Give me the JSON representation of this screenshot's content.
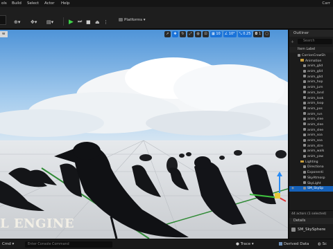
{
  "menu": {
    "items": [
      "ols",
      "Build",
      "Select",
      "Actor",
      "Help"
    ],
    "project_label": "Carr"
  },
  "toolbar": {
    "platforms_label": "Platforms",
    "play_color": "#3fd34a"
  },
  "viewport": {
    "mode_label": "w",
    "grid_snap": "10",
    "rotation_snap": "10°",
    "scale_snap": "0.25",
    "camera_speed": "1",
    "watermark": "L ENGINE",
    "gizmo_colors": {
      "x": "#e0383b",
      "y": "#3fbf3f",
      "z": "#2a8cf4"
    }
  },
  "outliner": {
    "title": "Outliner",
    "search_placeholder": "Search",
    "column_header": "Item Label",
    "rows": [
      {
        "label": "CarrionCrowSh",
        "type": "level"
      },
      {
        "label": "Animation",
        "type": "folder"
      },
      {
        "label": "anim_glid",
        "type": "actor"
      },
      {
        "label": "anim_glid",
        "type": "actor"
      },
      {
        "label": "anim_glid",
        "type": "actor"
      },
      {
        "label": "anim_hop",
        "type": "actor"
      },
      {
        "label": "anim_jum",
        "type": "actor"
      },
      {
        "label": "anim_land",
        "type": "actor"
      },
      {
        "label": "anim_look",
        "type": "actor"
      },
      {
        "label": "anim_loop",
        "type": "actor"
      },
      {
        "label": "anim_pos",
        "type": "actor"
      },
      {
        "label": "anim_run",
        "type": "actor"
      },
      {
        "label": "anim_slee",
        "type": "actor"
      },
      {
        "label": "anim_slee",
        "type": "actor"
      },
      {
        "label": "anim_slee",
        "type": "actor"
      },
      {
        "label": "anim_soa",
        "type": "actor"
      },
      {
        "label": "anim_soa",
        "type": "actor"
      },
      {
        "label": "anim_stre",
        "type": "actor"
      },
      {
        "label": "anim_walk",
        "type": "actor"
      },
      {
        "label": "anim_yaw",
        "type": "actor"
      },
      {
        "label": "Lighting",
        "type": "folder"
      },
      {
        "label": "Directiona",
        "type": "actor"
      },
      {
        "label": "Exponenti",
        "type": "actor"
      },
      {
        "label": "SkyAtmosp",
        "type": "actor"
      },
      {
        "label": "SkyLight",
        "type": "actor"
      },
      {
        "label": "SM_SkySp",
        "type": "actor",
        "selected": true
      }
    ],
    "footer": "44 actors (1 selected)"
  },
  "details": {
    "title": "Details",
    "object_name": "SM_SkySphere"
  },
  "statusbar": {
    "cmd_label": "Cmd",
    "console_placeholder": "Enter Console Command",
    "trace_label": "Trace",
    "derived_label": "Derived Data",
    "sc_label": "Sc"
  }
}
